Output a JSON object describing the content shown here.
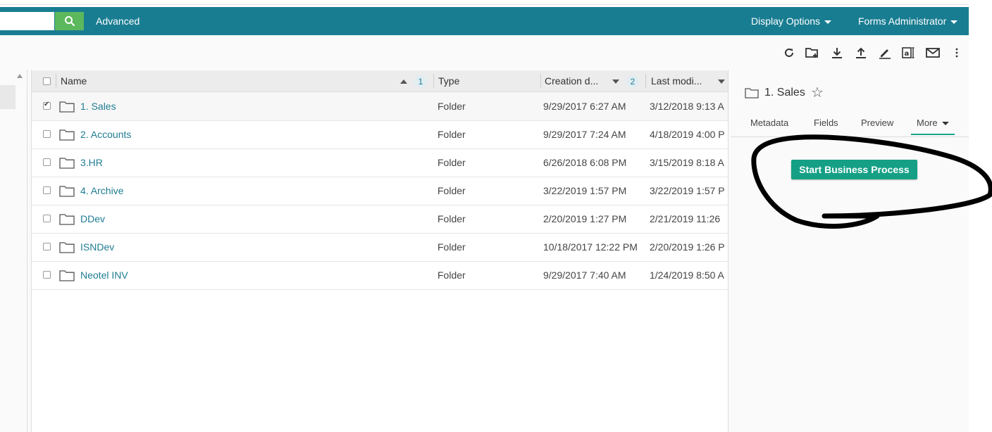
{
  "header": {
    "search_value": "",
    "advanced_label": "Advanced",
    "display_options_label": "Display Options",
    "user_label": "Forms Administrator",
    "bar_color": "#197d92",
    "search_button_color": "#5cb85c"
  },
  "toolbar": {
    "icons": [
      "refresh-icon",
      "new-folder-icon",
      "download-icon",
      "upload-icon",
      "edit-icon",
      "text-recognition-icon",
      "email-icon",
      "more-vertical-icon"
    ]
  },
  "grid": {
    "columns": {
      "name": "Name",
      "name_sort_order": "1",
      "type": "Type",
      "created": "Creation d...",
      "created_sort_order": "2",
      "modified": "Last modi..."
    },
    "rows": [
      {
        "name": "1. Sales",
        "type": "Folder",
        "created": "9/29/2017 6:27 AM",
        "modified": "3/12/2018 9:13 A",
        "checked": true
      },
      {
        "name": "2. Accounts",
        "type": "Folder",
        "created": "9/29/2017 7:24 AM",
        "modified": "4/18/2019 4:00 P",
        "checked": false
      },
      {
        "name": "3.HR",
        "type": "Folder",
        "created": "6/26/2018 6:08 PM",
        "modified": "3/15/2019 8:18 A",
        "checked": false
      },
      {
        "name": "4. Archive",
        "type": "Folder",
        "created": "3/22/2019 1:57 PM",
        "modified": "3/22/2019 1:57 P",
        "checked": false
      },
      {
        "name": "DDev",
        "type": "Folder",
        "created": "2/20/2019 1:27 PM",
        "modified": "2/21/2019 11:26",
        "checked": false
      },
      {
        "name": "ISNDev",
        "type": "Folder",
        "created": "10/18/2017 12:22 PM",
        "modified": "2/20/2019 1:26 P",
        "checked": false
      },
      {
        "name": "Neotel INV",
        "type": "Folder",
        "created": "9/29/2017 7:40 AM",
        "modified": "1/24/2019 8:50 A",
        "checked": false
      }
    ]
  },
  "details": {
    "title": "1. Sales",
    "tabs": {
      "metadata": "Metadata",
      "fields": "Fields",
      "preview": "Preview",
      "more": "More"
    },
    "start_bp_label": "Start Business Process",
    "button_color": "#15a085"
  }
}
